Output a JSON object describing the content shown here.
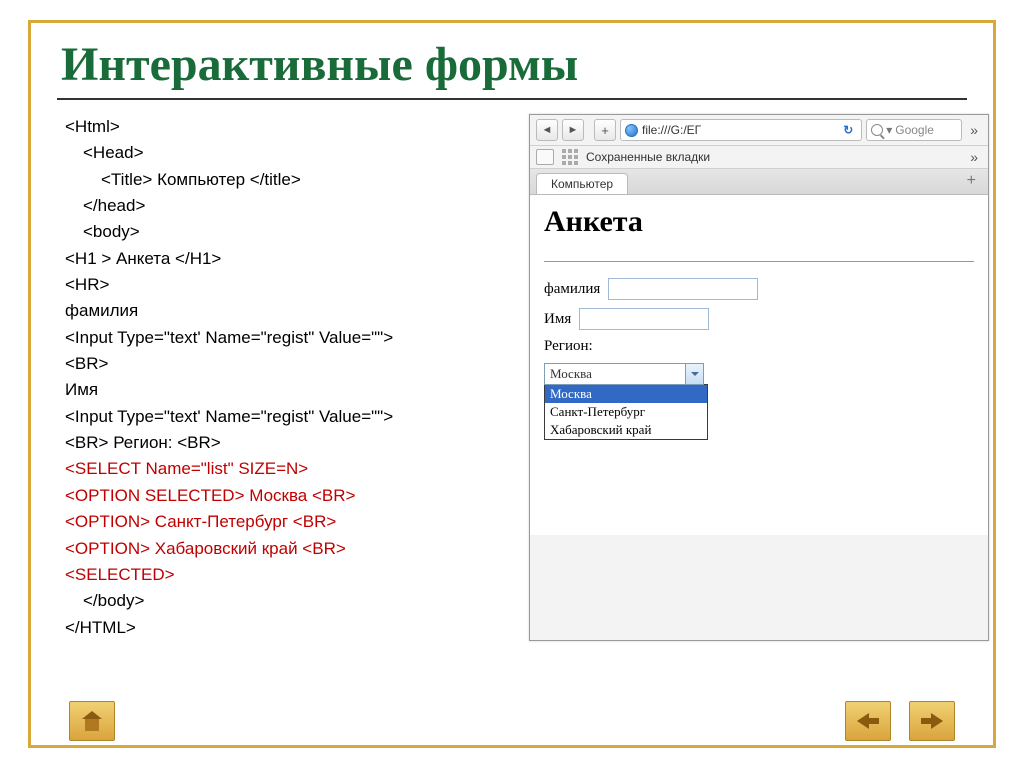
{
  "slide": {
    "title": "Интерактивные формы"
  },
  "code": {
    "lines": [
      {
        "cls": "",
        "ind": 0,
        "text": "<Html>"
      },
      {
        "cls": "",
        "ind": 1,
        "text": "<Head>"
      },
      {
        "cls": "",
        "ind": 2,
        "text": "<Title> Компьютер </title>"
      },
      {
        "cls": "",
        "ind": 1,
        "text": "</head>"
      },
      {
        "cls": "",
        "ind": 1,
        "text": "<body>"
      },
      {
        "cls": "",
        "ind": 0,
        "text": "<H1 > Анкета </H1>"
      },
      {
        "cls": "",
        "ind": 0,
        "text": "<HR>"
      },
      {
        "cls": "",
        "ind": 0,
        "text": "фамилия"
      },
      {
        "cls": "",
        "ind": 0,
        "text": "<Input Type=\"text' Name=\"regist\" Value=\"\">"
      },
      {
        "cls": "",
        "ind": 0,
        "text": "<BR>"
      },
      {
        "cls": "",
        "ind": 0,
        "text": "Имя"
      },
      {
        "cls": "",
        "ind": 0,
        "text": "<Input Type=\"text' Name=\"regist\" Value=\"\">"
      },
      {
        "cls": "",
        "ind": 0,
        "text": "<BR> Регион: <BR>"
      },
      {
        "cls": "red",
        "ind": 0,
        "text": "<SELECT Name=\"list\" SIZE=N>"
      },
      {
        "cls": "red",
        "ind": 0,
        "text": "<OPTION SELECTED> Москва <BR>"
      },
      {
        "cls": "red",
        "ind": 0,
        "text": "<OPTION> Санкт-Петербург <BR>"
      },
      {
        "cls": "red",
        "ind": 0,
        "text": "<OPTION> Хабаровский край <BR>"
      },
      {
        "cls": "red",
        "ind": 0,
        "text": "<SELECTED>"
      },
      {
        "cls": "",
        "ind": 0,
        "text": " "
      },
      {
        "cls": "",
        "ind": 1,
        "text": "</body>"
      },
      {
        "cls": "",
        "ind": 0,
        "text": "</HTML>"
      }
    ]
  },
  "browser": {
    "address": "file:///G:/ЕГ",
    "search_placeholder": "Google",
    "bookmarks_label": "Сохраненные вкладки",
    "tab_title": "Компьютер"
  },
  "page": {
    "heading": "Анкета",
    "label_lastname": "фамилия",
    "label_firstname": "Имя",
    "label_region": "Регион:",
    "select_value": "Москва",
    "options": [
      "Москва",
      "Санкт-Петербург",
      "Хабаровский край"
    ],
    "selected_index": 0
  }
}
